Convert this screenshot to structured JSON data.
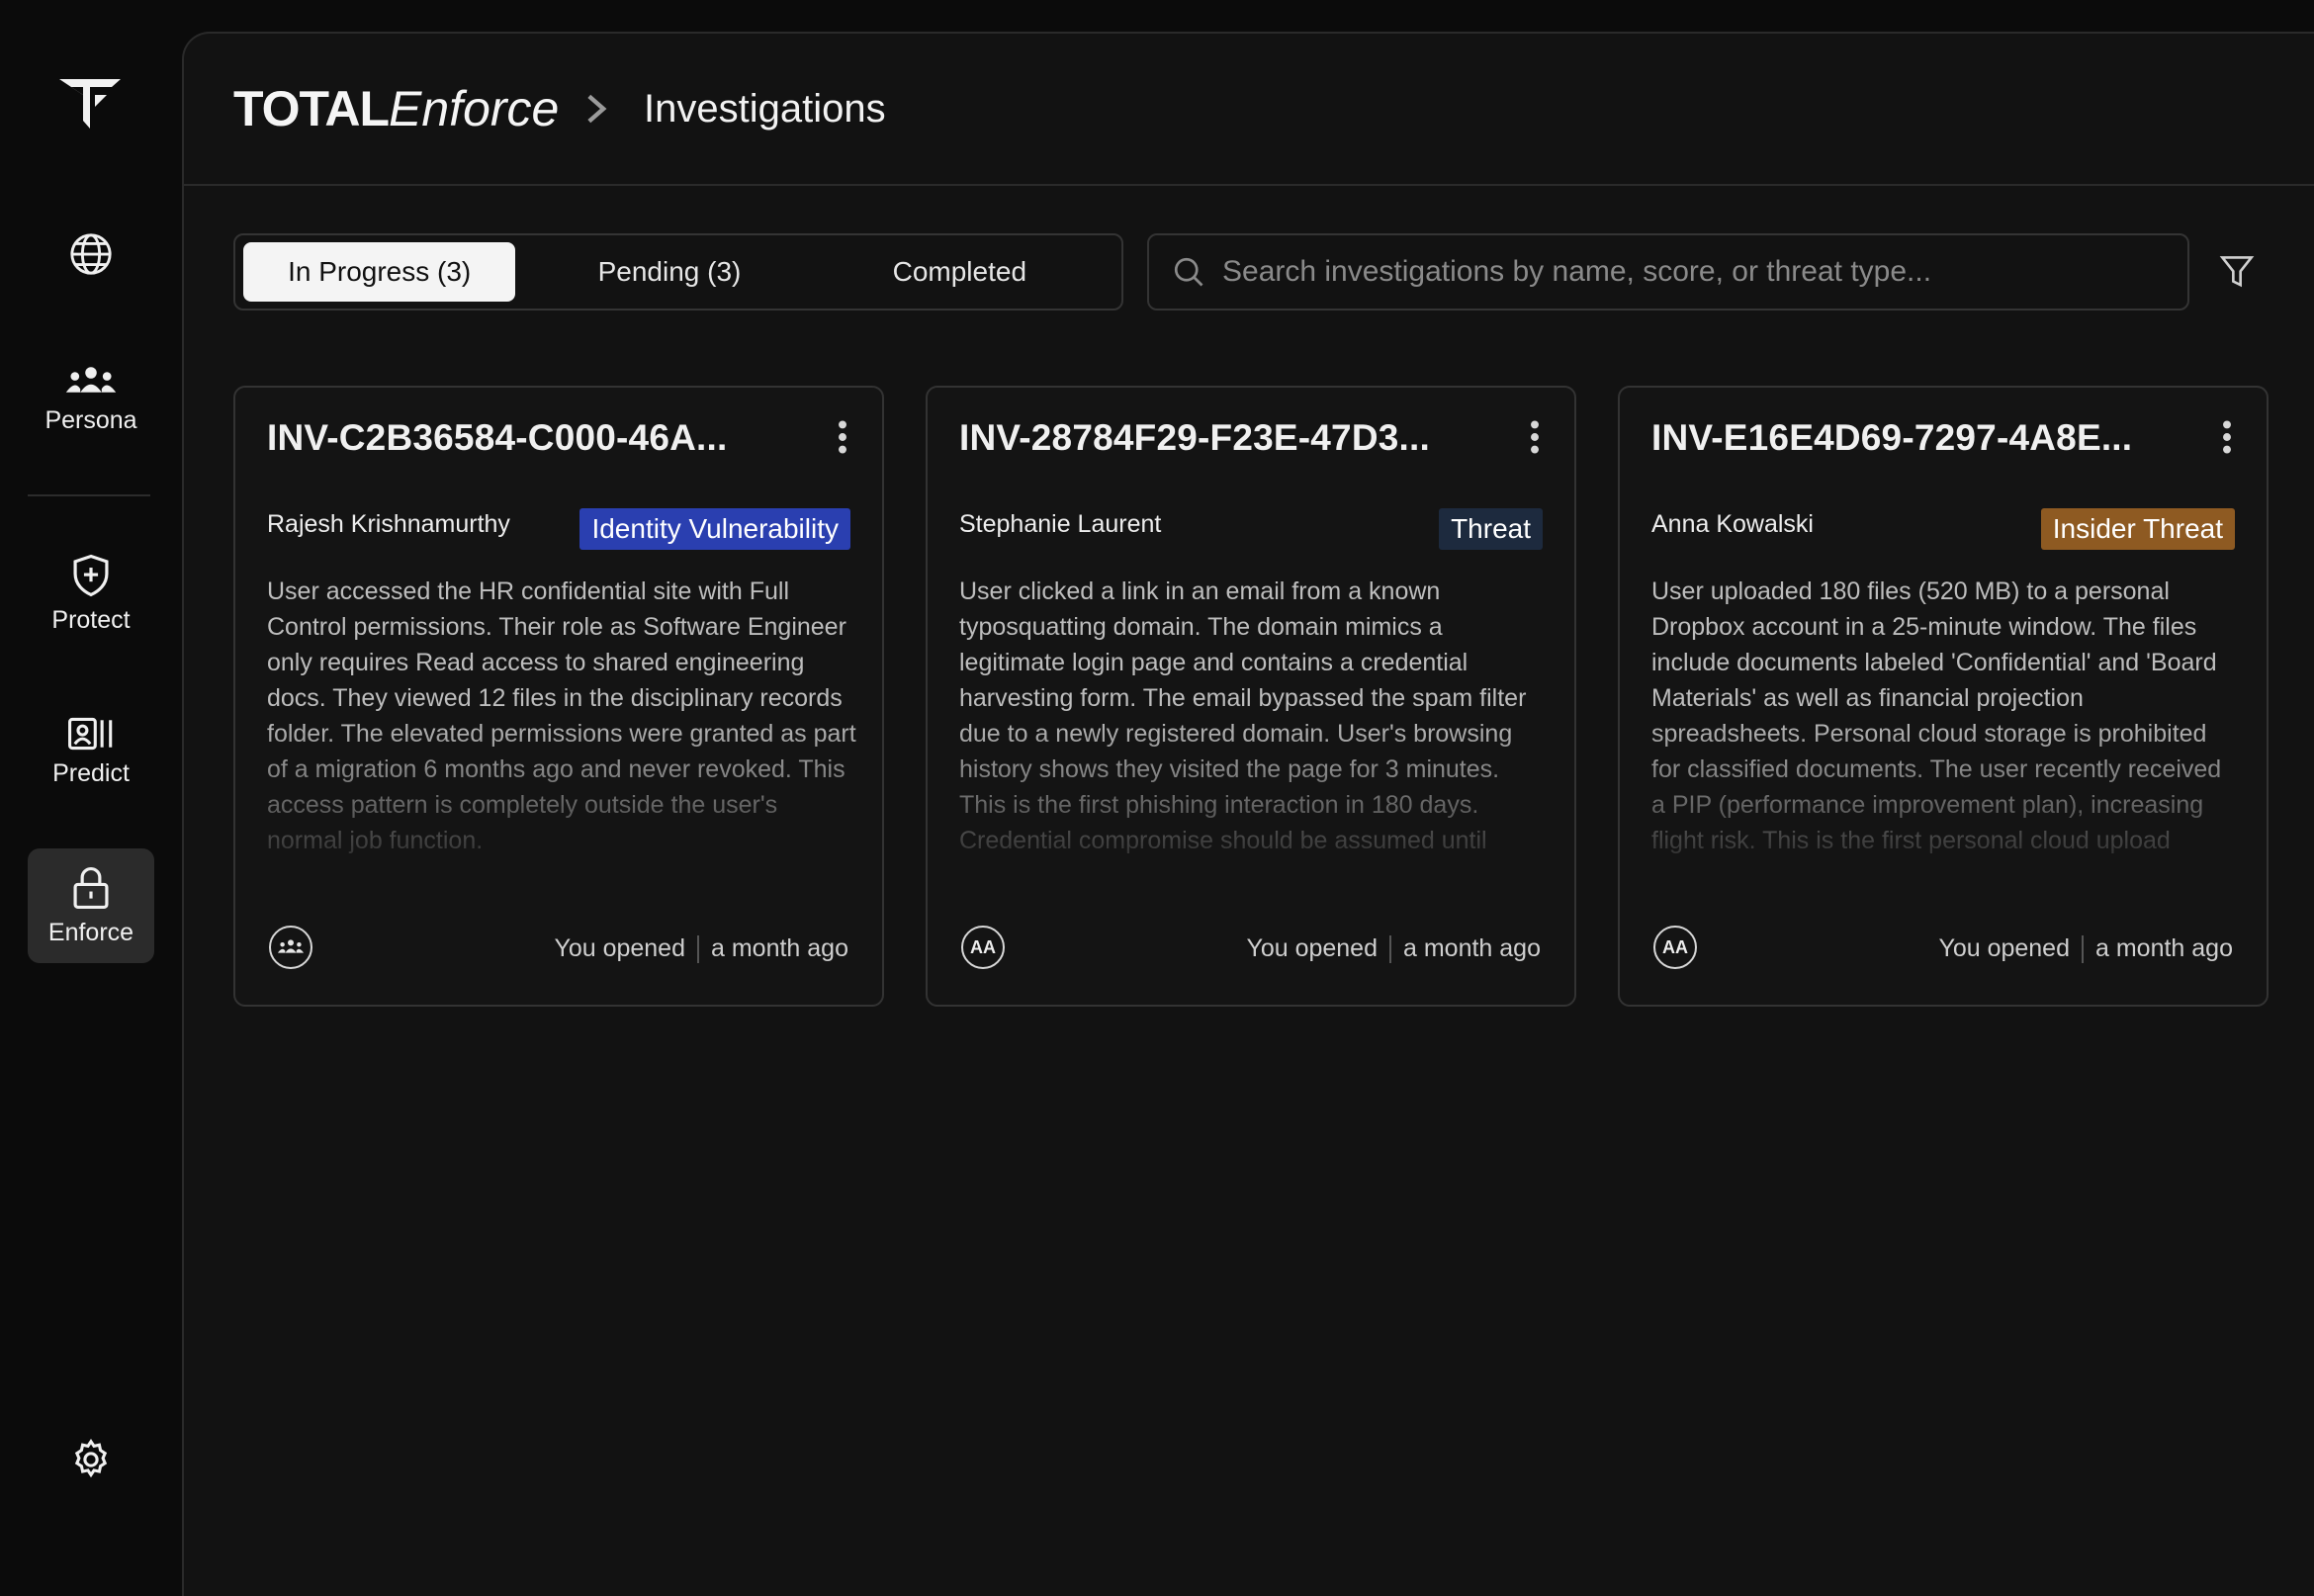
{
  "sidebar": {
    "items": [
      {
        "label": "",
        "icon": "globe-icon"
      },
      {
        "label": "Persona",
        "icon": "users-icon"
      },
      {
        "label": "Protect",
        "icon": "shield-plus-icon"
      },
      {
        "label": "Predict",
        "icon": "id-badge-icon"
      },
      {
        "label": "Enforce",
        "icon": "lock-icon",
        "active": true
      }
    ],
    "settings_icon": "gear-icon"
  },
  "header": {
    "brand_bold": "TOTAL",
    "brand_italic": "Enforce",
    "page_title": "Investigations"
  },
  "tabs": [
    {
      "label": "In Progress (3)",
      "active": true
    },
    {
      "label": "Pending (3)",
      "active": false
    },
    {
      "label": "Completed",
      "active": false
    }
  ],
  "search": {
    "placeholder": "Search investigations by name, score, or threat type..."
  },
  "cards": [
    {
      "title": "INV-C2B36584-C000-46A...",
      "person": "Rajesh Krishnamurthy",
      "badge": "Identity Vulnerability",
      "badge_color": "#2a3fb0",
      "description": "User accessed the HR confidential site with Full Control permissions. Their role as Software Engineer only requires Read access to shared engineering docs. They viewed 12 files in the disciplinary records folder. The elevated permissions were granted as part of a migration 6 months ago and never revoked. This access pattern is completely outside the user's normal job function.",
      "avatar": "",
      "avatar_icon": "users-icon",
      "opened": "You opened",
      "time": "a month ago"
    },
    {
      "title": "INV-28784F29-F23E-47D3...",
      "person": "Stephanie Laurent",
      "badge": "Threat",
      "badge_color": "#1d2a3e",
      "description": "User clicked a link in an email from a known typosquatting domain. The domain mimics a legitimate login page and contains a credential harvesting form. The email bypassed the spam filter due to a newly registered domain. User's browsing history shows they visited the page for 3 minutes. This is the first phishing interaction in 180 days. Credential compromise should be assumed until verified.",
      "avatar": "AA",
      "opened": "You opened",
      "time": "a month ago"
    },
    {
      "title": "INV-E16E4D69-7297-4A8E...",
      "person": "Anna Kowalski",
      "badge": "Insider Threat",
      "badge_color": "#8e5a22",
      "description": "User uploaded 180 files (520 MB) to a personal Dropbox account in a 25-minute window. The files include documents labeled 'Confidential' and 'Board Materials' as well as financial projection spreadsheets. Personal cloud storage is prohibited for classified documents. The user recently received a PIP (performance improvement plan), increasing flight risk. This is the first personal cloud upload detected for this user.",
      "avatar": "AA",
      "opened": "You opened",
      "time": "a month ago"
    }
  ]
}
